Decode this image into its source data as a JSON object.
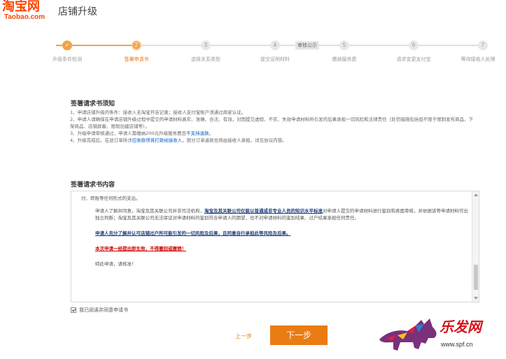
{
  "header": {
    "logo_cn": "淘宝网",
    "logo_en": "Taobao.com",
    "title": "店铺升级"
  },
  "steps": [
    {
      "num": "✓",
      "label": "升级条件检测",
      "status": "done"
    },
    {
      "num": "2",
      "label": "签署申请书",
      "status": "active"
    },
    {
      "num": "3",
      "label": "选择关系类型",
      "status": "todo"
    },
    {
      "num": "4",
      "label": "提交证明材料",
      "status": "todo"
    },
    {
      "num": "5",
      "label": "缴纳服务费",
      "status": "todo"
    },
    {
      "num": "6",
      "label": "请求变更支付宝",
      "status": "todo"
    },
    {
      "num": "7",
      "label": "等待接收人处理",
      "status": "todo"
    }
  ],
  "review_tag": "审核公示",
  "notice": {
    "title": "签署请求书须知",
    "items": [
      "1、申请店铺升级的条件：接收人无淘宝开店记录；接收人支付宝账户须通过商家认证。",
      "2、申请人请确保在申请店铺升级过程中提交的申请材料真实、准确、合法、有效，对因提交虚假、不实、失效申请材料所引发的后果承担一切风险和法律责任（处罚措施包括但不限于限制发布商品、下架商品、店铺屏蔽、限制创建店铺等）。",
      "3、升级申请审核通过，申请人需缴纳200元升级服务费且",
      "4、升级完成后，在途订单所涉",
      "，部分订单退款也将由接收人承担，详见协议内容。"
    ],
    "item3_blue": "不支持退款",
    "item3_end": "。",
    "item4_blue": "应收款项将打款给接收人"
  },
  "content": {
    "title": "签署请求书内容",
    "line0": "付、转账等任何形式的支出。",
    "para1_a": "申请人了解并同意，淘宝及其关联公司并非司法机构，",
    "para1_bold": "淘宝及其关联公司仅能以普通或非专业人员的知识水平标准",
    "para1_b": "对申请人提交的申请材料进行鉴别和表面审核，并依据该等申请材料作出独立判断；淘宝及其关联公司无法保证对申请材料的鉴别符合申请人的期望，也不对申请材料的鉴别结果、过户结果承担任何责任。",
    "para2": "申请人充分了解并认可店铺过户所可能引发的一切风险及后果，且同意自行承担此等风险及后果。",
    "para3": "本次申请一经提出即生效，不得撤回或撤销！",
    "para4": "特此申请，请核准！"
  },
  "agree_label": "我已阅读并同意申请书",
  "buttons": {
    "prev": "上一步",
    "next": "下一步"
  },
  "watermark": {
    "text": "乐发网",
    "url": "www.spf.cn"
  }
}
